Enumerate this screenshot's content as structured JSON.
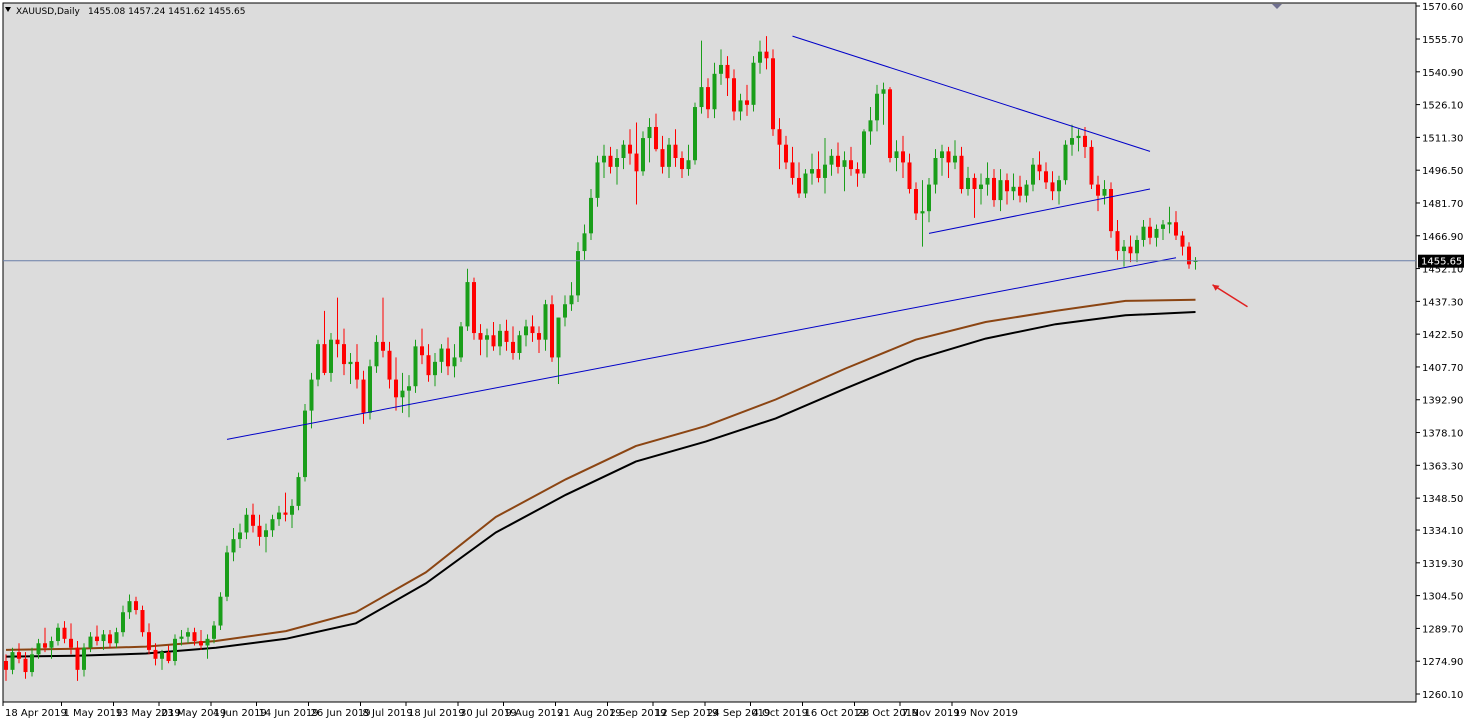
{
  "window": {
    "symbol": "XAUUSD,Daily",
    "ohlc": "1455.08 1457.24 1451.62 1455.65",
    "current_price_label": "1455.65"
  },
  "colors": {
    "plot_bg": "#dcdcdc",
    "bull": "#1a9e1a",
    "bear": "#ff0000",
    "grid_text": "#000000",
    "trendline": "#0000c8",
    "ma_fast": "#8b4513",
    "ma_slow": "#000000",
    "current_price_line": "#6a7fa8",
    "arrow": "#e02020"
  },
  "chart_data": {
    "type": "candlestick",
    "y_ticks": [
      "1570.60",
      "1555.70",
      "1540.90",
      "1526.10",
      "1511.30",
      "1496.50",
      "1481.70",
      "1466.90",
      "1452.10",
      "1437.30",
      "1422.50",
      "1407.70",
      "1392.90",
      "1378.10",
      "1363.30",
      "1348.50",
      "1334.10",
      "1319.30",
      "1304.50",
      "1289.70",
      "1274.90",
      "1260.10"
    ],
    "ylim": [
      1260.1,
      1570.6
    ],
    "x_ticks": [
      "18 Apr 2019",
      "1 May 2019",
      "13 May 2019",
      "23 May 2019",
      "4 Jun 2019",
      "14 Jun 2019",
      "26 Jun 2019",
      "8 Jul 2019",
      "18 Jul 2019",
      "30 Jul 2019",
      "9 Aug 2019",
      "21 Aug 2019",
      "2 Sep 2019",
      "12 Sep 2019",
      "24 Sep 2019",
      "4 Oct 2019",
      "16 Oct 2019",
      "28 Oct 2019",
      "7 Nov 2019",
      "19 Nov 2019"
    ],
    "candles": [
      [
        1275.0,
        1278.0,
        1266.0,
        1271.0
      ],
      [
        1271.0,
        1281.0,
        1269.0,
        1279.0
      ],
      [
        1279.0,
        1283.0,
        1274.0,
        1276.0
      ],
      [
        1276.0,
        1279.0,
        1267.0,
        1270.0
      ],
      [
        1270.0,
        1281.0,
        1268.0,
        1278.0
      ],
      [
        1278.0,
        1285.0,
        1276.0,
        1283.0
      ],
      [
        1283.0,
        1290.0,
        1279.0,
        1281.0
      ],
      [
        1281.0,
        1286.0,
        1276.0,
        1284.0
      ],
      [
        1284.0,
        1292.0,
        1282.0,
        1290.0
      ],
      [
        1290.0,
        1293.0,
        1283.0,
        1285.0
      ],
      [
        1285.0,
        1292.0,
        1278.0,
        1281.0
      ],
      [
        1281.0,
        1284.0,
        1266.0,
        1271.0
      ],
      [
        1271.0,
        1283.0,
        1268.0,
        1281.0
      ],
      [
        1281.0,
        1288.0,
        1279.0,
        1286.0
      ],
      [
        1286.0,
        1291.0,
        1282.0,
        1284.0
      ],
      [
        1284.0,
        1289.0,
        1280.0,
        1287.0
      ],
      [
        1287.0,
        1289.0,
        1281.0,
        1283.0
      ],
      [
        1283.0,
        1290.0,
        1281.0,
        1288.0
      ],
      [
        1288.0,
        1300.0,
        1286.0,
        1297.0
      ],
      [
        1297.0,
        1305.0,
        1294.0,
        1302.0
      ],
      [
        1302.0,
        1304.0,
        1296.0,
        1298.0
      ],
      [
        1298.0,
        1300.0,
        1286.0,
        1288.0
      ],
      [
        1288.0,
        1292.0,
        1278.0,
        1280.0
      ],
      [
        1280.0,
        1283.0,
        1273.0,
        1276.0
      ],
      [
        1276.0,
        1280.0,
        1271.0,
        1279.0
      ],
      [
        1279.0,
        1282.0,
        1274.0,
        1275.0
      ],
      [
        1275.0,
        1287.0,
        1273.0,
        1285.0
      ],
      [
        1285.0,
        1289.0,
        1282.0,
        1286.0
      ],
      [
        1286.0,
        1290.0,
        1283.0,
        1288.0
      ],
      [
        1288.0,
        1290.0,
        1282.0,
        1284.0
      ],
      [
        1284.0,
        1289.0,
        1280.0,
        1282.0
      ],
      [
        1282.0,
        1287.0,
        1276.0,
        1285.0
      ],
      [
        1285.0,
        1293.0,
        1283.0,
        1291.0
      ],
      [
        1291.0,
        1306.0,
        1289.0,
        1304.0
      ],
      [
        1304.0,
        1327.0,
        1302.0,
        1324.0
      ],
      [
        1324.0,
        1335.0,
        1320.0,
        1330.0
      ],
      [
        1330.0,
        1337.0,
        1326.0,
        1333.0
      ],
      [
        1333.0,
        1344.0,
        1330.0,
        1341.0
      ],
      [
        1341.0,
        1346.0,
        1333.0,
        1336.0
      ],
      [
        1336.0,
        1341.0,
        1327.0,
        1331.0
      ],
      [
        1331.0,
        1337.0,
        1324.0,
        1334.0
      ],
      [
        1334.0,
        1341.0,
        1331.0,
        1339.0
      ],
      [
        1339.0,
        1345.0,
        1336.0,
        1342.0
      ],
      [
        1342.0,
        1351.0,
        1338.0,
        1341.0
      ],
      [
        1341.0,
        1348.0,
        1335.0,
        1345.0
      ],
      [
        1345.0,
        1360.0,
        1343.0,
        1358.0
      ],
      [
        1358.0,
        1391.0,
        1356.0,
        1388.0
      ],
      [
        1388.0,
        1405.0,
        1380.0,
        1402.0
      ],
      [
        1402.0,
        1420.0,
        1399.0,
        1418.0
      ],
      [
        1418.0,
        1433.0,
        1404.0,
        1405.0
      ],
      [
        1405.0,
        1423.0,
        1401.0,
        1420.0
      ],
      [
        1420.0,
        1439.0,
        1412.0,
        1418.0
      ],
      [
        1418.0,
        1425.0,
        1404.0,
        1409.0
      ],
      [
        1409.0,
        1414.0,
        1400.0,
        1410.0
      ],
      [
        1410.0,
        1418.0,
        1398.0,
        1402.0
      ],
      [
        1402.0,
        1406.0,
        1382.0,
        1387.0
      ],
      [
        1387.0,
        1411.0,
        1384.0,
        1408.0
      ],
      [
        1408.0,
        1422.0,
        1405.0,
        1419.0
      ],
      [
        1419.0,
        1439.0,
        1412.0,
        1415.0
      ],
      [
        1415.0,
        1419.0,
        1398.0,
        1402.0
      ],
      [
        1402.0,
        1412.0,
        1388.0,
        1394.0
      ],
      [
        1394.0,
        1405.0,
        1387.0,
        1397.0
      ],
      [
        1397.0,
        1404.0,
        1385.0,
        1399.0
      ],
      [
        1399.0,
        1420.0,
        1396.0,
        1417.0
      ],
      [
        1417.0,
        1425.0,
        1409.0,
        1413.0
      ],
      [
        1413.0,
        1418.0,
        1401.0,
        1404.0
      ],
      [
        1404.0,
        1414.0,
        1399.0,
        1410.0
      ],
      [
        1410.0,
        1418.0,
        1405.0,
        1416.0
      ],
      [
        1416.0,
        1421.0,
        1404.0,
        1408.0
      ],
      [
        1408.0,
        1418.0,
        1403.0,
        1412.0
      ],
      [
        1412.0,
        1428.0,
        1410.0,
        1426.0
      ],
      [
        1426.0,
        1452.0,
        1424.0,
        1446.0
      ],
      [
        1446.0,
        1448.0,
        1420.0,
        1423.0
      ],
      [
        1423.0,
        1427.0,
        1413.0,
        1420.0
      ],
      [
        1420.0,
        1425.0,
        1412.0,
        1422.0
      ],
      [
        1422.0,
        1428.0,
        1415.0,
        1417.0
      ],
      [
        1417.0,
        1427.0,
        1413.0,
        1424.0
      ],
      [
        1424.0,
        1429.0,
        1415.0,
        1419.0
      ],
      [
        1419.0,
        1426.0,
        1411.0,
        1414.0
      ],
      [
        1414.0,
        1424.0,
        1411.0,
        1422.0
      ],
      [
        1422.0,
        1429.0,
        1417.0,
        1426.0
      ],
      [
        1426.0,
        1431.0,
        1419.0,
        1423.0
      ],
      [
        1423.0,
        1426.0,
        1414.0,
        1420.0
      ],
      [
        1420.0,
        1438.0,
        1415.0,
        1436.0
      ],
      [
        1436.0,
        1440.0,
        1410.0,
        1412.0
      ],
      [
        1412.0,
        1430.0,
        1400.0,
        1430.0
      ],
      [
        1430.0,
        1440.0,
        1426.0,
        1436.0
      ],
      [
        1436.0,
        1446.0,
        1433.0,
        1440.0
      ],
      [
        1440.0,
        1464.0,
        1437.0,
        1460.0
      ],
      [
        1460.0,
        1472.0,
        1456.0,
        1468.0
      ],
      [
        1468.0,
        1488.0,
        1465.0,
        1484.0
      ],
      [
        1484.0,
        1503.0,
        1480.0,
        1500.0
      ],
      [
        1500.0,
        1508.0,
        1493.0,
        1503.0
      ],
      [
        1503.0,
        1507.0,
        1495.0,
        1498.0
      ],
      [
        1498.0,
        1506.0,
        1490.0,
        1502.0
      ],
      [
        1502.0,
        1510.0,
        1497.0,
        1508.0
      ],
      [
        1508.0,
        1515.0,
        1499.0,
        1504.0
      ],
      [
        1504.0,
        1518.0,
        1481.0,
        1496.0
      ],
      [
        1496.0,
        1514.0,
        1494.0,
        1511.0
      ],
      [
        1511.0,
        1520.0,
        1500.0,
        1516.0
      ],
      [
        1516.0,
        1522.0,
        1505.0,
        1506.0
      ],
      [
        1506.0,
        1512.0,
        1495.0,
        1498.0
      ],
      [
        1498.0,
        1511.0,
        1493.0,
        1508.0
      ],
      [
        1508.0,
        1515.0,
        1498.0,
        1502.0
      ],
      [
        1502.0,
        1505.0,
        1493.0,
        1497.0
      ],
      [
        1497.0,
        1508.0,
        1494.0,
        1501.0
      ],
      [
        1501.0,
        1527.0,
        1499.0,
        1525.0
      ],
      [
        1525.0,
        1555.0,
        1522.0,
        1534.0
      ],
      [
        1534.0,
        1538.0,
        1520.0,
        1524.0
      ],
      [
        1524.0,
        1545.0,
        1520.0,
        1540.0
      ],
      [
        1540.0,
        1551.0,
        1535.0,
        1544.0
      ],
      [
        1544.0,
        1548.0,
        1530.0,
        1538.0
      ],
      [
        1538.0,
        1542.0,
        1519.0,
        1523.0
      ],
      [
        1523.0,
        1531.0,
        1519.0,
        1528.0
      ],
      [
        1528.0,
        1535.0,
        1521.0,
        1526.0
      ],
      [
        1526.0,
        1548.0,
        1523.0,
        1545.0
      ],
      [
        1545.0,
        1555.0,
        1540.0,
        1550.0
      ],
      [
        1550.0,
        1557.0,
        1542.0,
        1547.0
      ],
      [
        1547.0,
        1551.0,
        1512.0,
        1515.0
      ],
      [
        1515.0,
        1520.0,
        1497.0,
        1508.0
      ],
      [
        1508.0,
        1512.0,
        1497.0,
        1500.0
      ],
      [
        1500.0,
        1507.0,
        1490.0,
        1493.0
      ],
      [
        1493.0,
        1500.0,
        1484.0,
        1486.0
      ],
      [
        1486.0,
        1497.0,
        1484.0,
        1495.0
      ],
      [
        1495.0,
        1504.0,
        1490.0,
        1497.0
      ],
      [
        1497.0,
        1505.0,
        1491.0,
        1493.0
      ],
      [
        1493.0,
        1511.0,
        1486.0,
        1499.0
      ],
      [
        1499.0,
        1506.0,
        1494.0,
        1503.0
      ],
      [
        1503.0,
        1509.0,
        1495.0,
        1498.0
      ],
      [
        1498.0,
        1505.0,
        1487.0,
        1501.0
      ],
      [
        1501.0,
        1507.0,
        1494.0,
        1497.0
      ],
      [
        1497.0,
        1500.0,
        1489.0,
        1495.0
      ],
      [
        1495.0,
        1515.0,
        1493.0,
        1514.0
      ],
      [
        1514.0,
        1525.0,
        1508.0,
        1519.0
      ],
      [
        1519.0,
        1535.0,
        1514.0,
        1531.0
      ],
      [
        1531.0,
        1536.0,
        1517.0,
        1533.0
      ],
      [
        1533.0,
        1534.0,
        1500.0,
        1502.0
      ],
      [
        1502.0,
        1510.0,
        1496.0,
        1505.0
      ],
      [
        1505.0,
        1512.0,
        1493.0,
        1500.0
      ],
      [
        1500.0,
        1504.0,
        1486.0,
        1488.0
      ],
      [
        1488.0,
        1491.0,
        1474.0,
        1477.0
      ],
      [
        1477.0,
        1492.0,
        1462.0,
        1478.0
      ],
      [
        1478.0,
        1493.0,
        1473.0,
        1490.0
      ],
      [
        1490.0,
        1506.0,
        1486.0,
        1502.0
      ],
      [
        1502.0,
        1508.0,
        1494.0,
        1505.0
      ],
      [
        1505.0,
        1507.0,
        1493.0,
        1500.0
      ],
      [
        1500.0,
        1510.0,
        1497.0,
        1503.0
      ],
      [
        1503.0,
        1507.0,
        1486.0,
        1488.0
      ],
      [
        1488.0,
        1498.0,
        1485.0,
        1493.0
      ],
      [
        1493.0,
        1495.0,
        1475.0,
        1488.0
      ],
      [
        1488.0,
        1495.0,
        1481.0,
        1490.0
      ],
      [
        1490.0,
        1500.0,
        1485.0,
        1493.0
      ],
      [
        1493.0,
        1497.0,
        1480.0,
        1483.0
      ],
      [
        1483.0,
        1497.0,
        1478.0,
        1492.0
      ],
      [
        1492.0,
        1495.0,
        1481.0,
        1487.0
      ],
      [
        1487.0,
        1495.0,
        1483.0,
        1489.0
      ],
      [
        1489.0,
        1494.0,
        1482.0,
        1485.0
      ],
      [
        1485.0,
        1492.0,
        1482.0,
        1490.0
      ],
      [
        1490.0,
        1502.0,
        1487.0,
        1499.0
      ],
      [
        1499.0,
        1505.0,
        1492.0,
        1496.0
      ],
      [
        1496.0,
        1500.0,
        1488.0,
        1491.0
      ],
      [
        1491.0,
        1496.0,
        1483.0,
        1487.0
      ],
      [
        1487.0,
        1494.0,
        1481.0,
        1492.0
      ],
      [
        1492.0,
        1510.0,
        1490.0,
        1508.0
      ],
      [
        1508.0,
        1517.0,
        1503.0,
        1511.0
      ],
      [
        1511.0,
        1515.0,
        1505.0,
        1512.0
      ],
      [
        1512.0,
        1516.0,
        1502.0,
        1507.0
      ],
      [
        1507.0,
        1510.0,
        1488.0,
        1490.0
      ],
      [
        1490.0,
        1494.0,
        1478.0,
        1485.0
      ],
      [
        1485.0,
        1492.0,
        1481.0,
        1488.0
      ],
      [
        1488.0,
        1491.0,
        1466.0,
        1469.0
      ],
      [
        1469.0,
        1474.0,
        1456.0,
        1460.0
      ],
      [
        1460.0,
        1465.0,
        1453.0,
        1462.0
      ],
      [
        1462.0,
        1467.0,
        1455.0,
        1459.0
      ],
      [
        1459.0,
        1467.0,
        1455.0,
        1465.0
      ],
      [
        1465.0,
        1474.0,
        1462.0,
        1471.0
      ],
      [
        1471.0,
        1475.0,
        1463.0,
        1466.0
      ],
      [
        1466.0,
        1472.0,
        1462.0,
        1470.0
      ],
      [
        1470.0,
        1474.0,
        1465.0,
        1472.0
      ],
      [
        1472.0,
        1480.0,
        1468.0,
        1473.0
      ],
      [
        1473.0,
        1478.0,
        1465.0,
        1467.0
      ],
      [
        1467.0,
        1469.0,
        1458.0,
        1462.0
      ],
      [
        1462.0,
        1464.0,
        1452.0,
        1454.0
      ],
      [
        1455.08,
        1457.24,
        1451.62,
        1455.65
      ]
    ],
    "ma_fast": [
      1280.0,
      1280.5,
      1281.5,
      1284.0,
      1288.5,
      1297.0,
      1315.0,
      1340.0,
      1357.0,
      1372.0,
      1381.0,
      1393.0,
      1407.0,
      1420.0,
      1428.0,
      1433.0,
      1437.5,
      1438.0
    ],
    "ma_slow": [
      1277.0,
      1277.4,
      1278.4,
      1281.0,
      1285.0,
      1292.0,
      1310.0,
      1333.0,
      1350.0,
      1365.0,
      1374.0,
      1384.5,
      1398.0,
      1411.0,
      1420.5,
      1427.0,
      1431.0,
      1432.5
    ],
    "trendlines": [
      {
        "from": [
          34,
          1375.0
        ],
        "to": [
          180,
          1457.0
        ]
      },
      {
        "from": [
          121,
          1557.0
        ],
        "to": [
          176,
          1505.0
        ]
      },
      {
        "from": [
          142,
          1468.0
        ],
        "to": [
          176,
          1488.0
        ]
      }
    ],
    "current_price": 1455.65
  }
}
